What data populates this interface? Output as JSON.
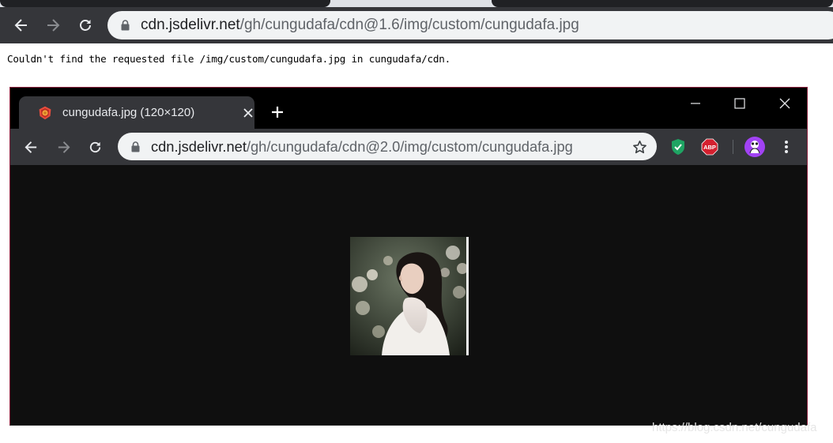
{
  "outer": {
    "url_host": "cdn.jsdelivr.net",
    "url_path": "/gh/cungudafa/cdn@1.6/img/custom/cungudafa.jpg",
    "error_message": "Couldn't find the requested file /img/custom/cungudafa.jpg in cungudafa/cdn."
  },
  "inner": {
    "tab_title": "cungudafa.jpg (120×120)",
    "url_host": "cdn.jsdelivr.net",
    "url_path": "/gh/cungudafa/cdn@2.0/img/custom/cungudafa.jpg",
    "extensions": [
      "shield-check-icon",
      "adblock-plus-icon",
      "profile-avatar-icon"
    ],
    "abp_label": "ABP"
  },
  "watermark": "https://blog.csdn.net/cungudafa",
  "colors": {
    "toolbar": "#35363a",
    "omnibox": "#f1f3f4",
    "page_bg": "#0f0f0f",
    "shield": "#1fa463",
    "abp": "#d4202f",
    "avatar": "#a142f4"
  }
}
